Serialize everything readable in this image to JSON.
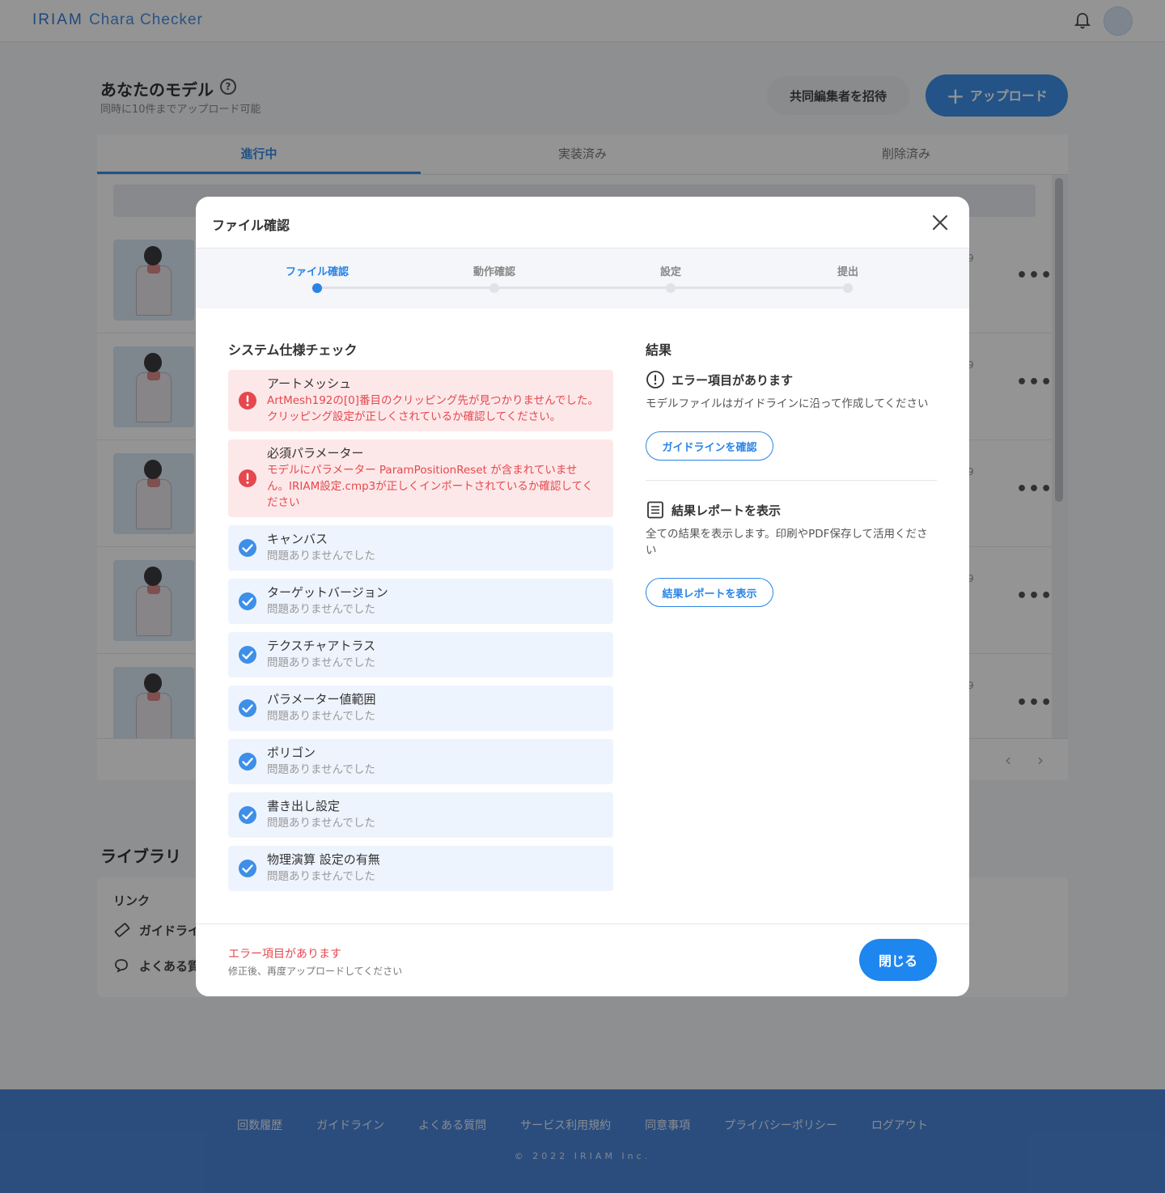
{
  "header": {
    "logo_part1": "IRIAM ",
    "logo_part2": "Chara Checker",
    "bell_icon": "bell-icon",
    "avatar_icon": "avatar-icon"
  },
  "page": {
    "title": "あなたのモデル",
    "help_symbol": "?",
    "subtitle": "同時に10件までアップロード可能",
    "invite_label": "共同編集者を招待",
    "upload_label": "アップロード",
    "upload_plus": "+"
  },
  "tabs": [
    {
      "label": "進行中",
      "active": true
    },
    {
      "label": "実装済み",
      "active": false
    },
    {
      "label": "削除済み",
      "active": false
    }
  ],
  "rows": [
    {
      "date": "9",
      "more": "•••"
    },
    {
      "date": "9",
      "more": "•••"
    },
    {
      "date": "9",
      "more": "•••"
    },
    {
      "date": "9",
      "more": "•••"
    },
    {
      "date": "9",
      "more": "•••"
    }
  ],
  "pager": {
    "prev": "‹",
    "next": "›"
  },
  "library": {
    "title": "ライブラリ",
    "link_heading": "リンク",
    "items": [
      "ガイドライ",
      "よくある質"
    ]
  },
  "footer": {
    "links": [
      "回数履歴",
      "ガイドライン",
      "よくある質問",
      "サービス利用規約",
      "同意事項",
      "プライバシーポリシー",
      "ログアウト"
    ],
    "copyright": "© 2022 IRIAM Inc."
  },
  "modal": {
    "title": "ファイル確認",
    "steps": [
      {
        "label": "ファイル確認",
        "active": true
      },
      {
        "label": "動作確認",
        "active": false
      },
      {
        "label": "設定",
        "active": false
      },
      {
        "label": "提出",
        "active": false
      }
    ],
    "checks_title": "システム仕様チェック",
    "checks": [
      {
        "name": "アートメッシュ",
        "message": "ArtMesh192の[0]番目のクリッピング先が見つかりませんでした。クリッピング設定が正しくされているか確認してください。",
        "status": "error"
      },
      {
        "name": "必須パラメーター",
        "message": "モデルにパラメーター ParamPositionReset が含まれていません。IRIAM設定.cmp3が正しくインポートされているか確認してください",
        "status": "error"
      },
      {
        "name": "キャンバス",
        "message": "問題ありませんでした",
        "status": "ok"
      },
      {
        "name": "ターゲットバージョン",
        "message": "問題ありませんでした",
        "status": "ok"
      },
      {
        "name": "テクスチャアトラス",
        "message": "問題ありませんでした",
        "status": "ok"
      },
      {
        "name": "パラメーター値範囲",
        "message": "問題ありませんでした",
        "status": "ok"
      },
      {
        "name": "ポリゴン",
        "message": "問題ありませんでした",
        "status": "ok"
      },
      {
        "name": "書き出し設定",
        "message": "問題ありませんでした",
        "status": "ok"
      },
      {
        "name": "物理演算 設定の有無",
        "message": "問題ありませんでした",
        "status": "ok"
      }
    ],
    "result": {
      "title": "結果",
      "error_heading": "エラー項目があります",
      "error_text": "モデルファイルはガイドラインに沿って作成してください",
      "guideline_button": "ガイドラインを確認",
      "report_heading": "結果レポートを表示",
      "report_text": "全ての結果を表示します。印刷やPDF保存して活用ください",
      "report_button": "結果レポートを表示"
    },
    "footer": {
      "error_text": "エラー項目があります",
      "sub_text": "修正後、再度アップロードしてください",
      "close_button": "閉じる"
    },
    "colors": {
      "accent": "#1e86ef",
      "error": "#e5484d",
      "ok_bg": "#eef4fe",
      "err_bg": "#fde8e9"
    }
  }
}
